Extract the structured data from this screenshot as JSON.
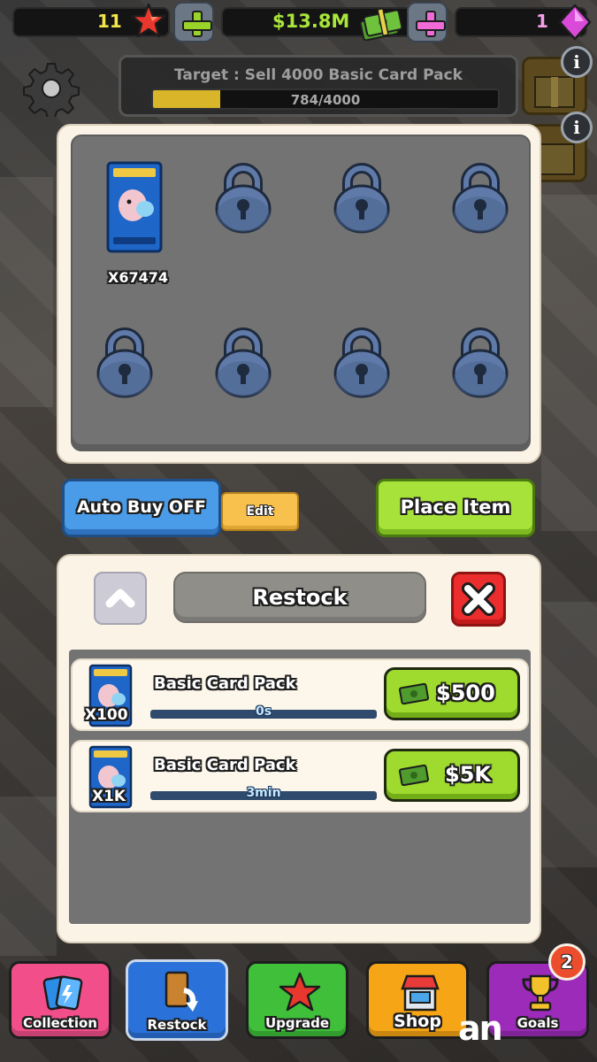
{
  "hud": {
    "stars": "11",
    "cash": "$13.8M",
    "gems": "1"
  },
  "target": {
    "label": "Target : Sell 4000 Basic Card Pack",
    "progress_text": "784/4000",
    "progress": 0.196
  },
  "inventory": {
    "pack_count": "X67474",
    "locked_slots": 7
  },
  "actions": {
    "auto_buy": "Auto Buy OFF",
    "edit": "Edit",
    "place_item": "Place Item"
  },
  "restock": {
    "title": "Restock",
    "rows": [
      {
        "name": "Basic Card Pack",
        "qty": "X100",
        "time": "0s",
        "price": "$500"
      },
      {
        "name": "Basic Card Pack",
        "qty": "X1K",
        "time": "3min",
        "price": "$5K"
      }
    ]
  },
  "nav": {
    "items": [
      {
        "label": "Collection",
        "color": "#f24f8a"
      },
      {
        "label": "Restock",
        "color": "#2a72d9"
      },
      {
        "label": "Upgrade",
        "color": "#3fbf3a"
      },
      {
        "label": "Shop",
        "color": "#f6a516"
      },
      {
        "label": "Goals",
        "color": "#9b2bb8"
      }
    ],
    "goals_badge": "2"
  },
  "watermark": "an"
}
